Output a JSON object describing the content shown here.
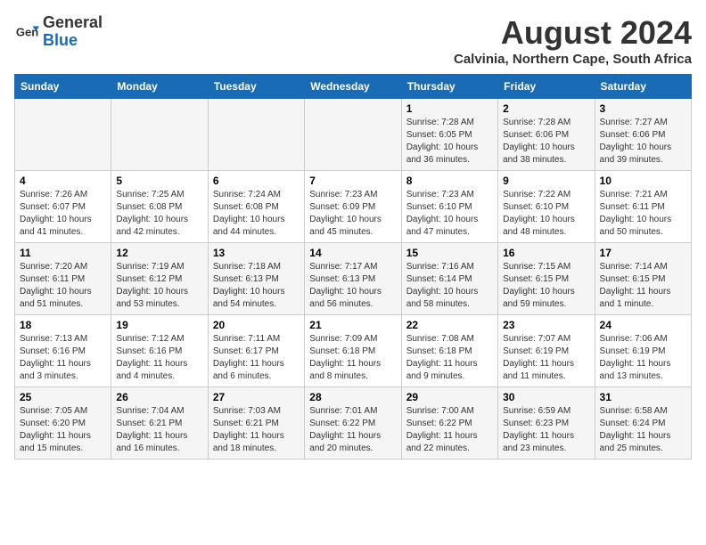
{
  "header": {
    "logo_line1": "General",
    "logo_line2": "Blue",
    "month_year": "August 2024",
    "location": "Calvinia, Northern Cape, South Africa"
  },
  "days_of_week": [
    "Sunday",
    "Monday",
    "Tuesday",
    "Wednesday",
    "Thursday",
    "Friday",
    "Saturday"
  ],
  "weeks": [
    [
      {
        "day": "",
        "info": ""
      },
      {
        "day": "",
        "info": ""
      },
      {
        "day": "",
        "info": ""
      },
      {
        "day": "",
        "info": ""
      },
      {
        "day": "1",
        "info": "Sunrise: 7:28 AM\nSunset: 6:05 PM\nDaylight: 10 hours\nand 36 minutes."
      },
      {
        "day": "2",
        "info": "Sunrise: 7:28 AM\nSunset: 6:06 PM\nDaylight: 10 hours\nand 38 minutes."
      },
      {
        "day": "3",
        "info": "Sunrise: 7:27 AM\nSunset: 6:06 PM\nDaylight: 10 hours\nand 39 minutes."
      }
    ],
    [
      {
        "day": "4",
        "info": "Sunrise: 7:26 AM\nSunset: 6:07 PM\nDaylight: 10 hours\nand 41 minutes."
      },
      {
        "day": "5",
        "info": "Sunrise: 7:25 AM\nSunset: 6:08 PM\nDaylight: 10 hours\nand 42 minutes."
      },
      {
        "day": "6",
        "info": "Sunrise: 7:24 AM\nSunset: 6:08 PM\nDaylight: 10 hours\nand 44 minutes."
      },
      {
        "day": "7",
        "info": "Sunrise: 7:23 AM\nSunset: 6:09 PM\nDaylight: 10 hours\nand 45 minutes."
      },
      {
        "day": "8",
        "info": "Sunrise: 7:23 AM\nSunset: 6:10 PM\nDaylight: 10 hours\nand 47 minutes."
      },
      {
        "day": "9",
        "info": "Sunrise: 7:22 AM\nSunset: 6:10 PM\nDaylight: 10 hours\nand 48 minutes."
      },
      {
        "day": "10",
        "info": "Sunrise: 7:21 AM\nSunset: 6:11 PM\nDaylight: 10 hours\nand 50 minutes."
      }
    ],
    [
      {
        "day": "11",
        "info": "Sunrise: 7:20 AM\nSunset: 6:11 PM\nDaylight: 10 hours\nand 51 minutes."
      },
      {
        "day": "12",
        "info": "Sunrise: 7:19 AM\nSunset: 6:12 PM\nDaylight: 10 hours\nand 53 minutes."
      },
      {
        "day": "13",
        "info": "Sunrise: 7:18 AM\nSunset: 6:13 PM\nDaylight: 10 hours\nand 54 minutes."
      },
      {
        "day": "14",
        "info": "Sunrise: 7:17 AM\nSunset: 6:13 PM\nDaylight: 10 hours\nand 56 minutes."
      },
      {
        "day": "15",
        "info": "Sunrise: 7:16 AM\nSunset: 6:14 PM\nDaylight: 10 hours\nand 58 minutes."
      },
      {
        "day": "16",
        "info": "Sunrise: 7:15 AM\nSunset: 6:15 PM\nDaylight: 10 hours\nand 59 minutes."
      },
      {
        "day": "17",
        "info": "Sunrise: 7:14 AM\nSunset: 6:15 PM\nDaylight: 11 hours\nand 1 minute."
      }
    ],
    [
      {
        "day": "18",
        "info": "Sunrise: 7:13 AM\nSunset: 6:16 PM\nDaylight: 11 hours\nand 3 minutes."
      },
      {
        "day": "19",
        "info": "Sunrise: 7:12 AM\nSunset: 6:16 PM\nDaylight: 11 hours\nand 4 minutes."
      },
      {
        "day": "20",
        "info": "Sunrise: 7:11 AM\nSunset: 6:17 PM\nDaylight: 11 hours\nand 6 minutes."
      },
      {
        "day": "21",
        "info": "Sunrise: 7:09 AM\nSunset: 6:18 PM\nDaylight: 11 hours\nand 8 minutes."
      },
      {
        "day": "22",
        "info": "Sunrise: 7:08 AM\nSunset: 6:18 PM\nDaylight: 11 hours\nand 9 minutes."
      },
      {
        "day": "23",
        "info": "Sunrise: 7:07 AM\nSunset: 6:19 PM\nDaylight: 11 hours\nand 11 minutes."
      },
      {
        "day": "24",
        "info": "Sunrise: 7:06 AM\nSunset: 6:19 PM\nDaylight: 11 hours\nand 13 minutes."
      }
    ],
    [
      {
        "day": "25",
        "info": "Sunrise: 7:05 AM\nSunset: 6:20 PM\nDaylight: 11 hours\nand 15 minutes."
      },
      {
        "day": "26",
        "info": "Sunrise: 7:04 AM\nSunset: 6:21 PM\nDaylight: 11 hours\nand 16 minutes."
      },
      {
        "day": "27",
        "info": "Sunrise: 7:03 AM\nSunset: 6:21 PM\nDaylight: 11 hours\nand 18 minutes."
      },
      {
        "day": "28",
        "info": "Sunrise: 7:01 AM\nSunset: 6:22 PM\nDaylight: 11 hours\nand 20 minutes."
      },
      {
        "day": "29",
        "info": "Sunrise: 7:00 AM\nSunset: 6:22 PM\nDaylight: 11 hours\nand 22 minutes."
      },
      {
        "day": "30",
        "info": "Sunrise: 6:59 AM\nSunset: 6:23 PM\nDaylight: 11 hours\nand 23 minutes."
      },
      {
        "day": "31",
        "info": "Sunrise: 6:58 AM\nSunset: 6:24 PM\nDaylight: 11 hours\nand 25 minutes."
      }
    ]
  ]
}
